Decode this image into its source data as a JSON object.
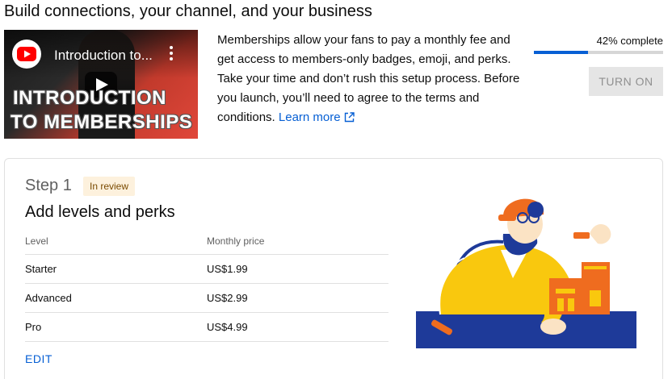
{
  "header": {
    "title": "Build connections, your channel, and your business"
  },
  "video": {
    "title": "Introduction to...",
    "overlay_line1": "INTRODUCTION",
    "overlay_line2": "TO MEMBERSHIPS",
    "logo_icon": "youtube-logo-icon",
    "menu_icon": "kebab-menu-icon",
    "play_icon": "play-icon"
  },
  "description": {
    "text": "Memberships allow your fans to pay a monthly fee and get access to members-only badges, emoji, and perks. Take your time and don’t rush this setup process. Before you launch, you’ll need to agree to the terms and conditions.",
    "link_label": "Learn more",
    "link_icon": "external-link-icon"
  },
  "progress": {
    "label": "42% complete",
    "value": 0.42
  },
  "actions": {
    "turn_on_label": "TURN ON"
  },
  "step": {
    "label": "Step 1",
    "status_badge": "In review",
    "title": "Add levels and perks",
    "table": {
      "columns": [
        "Level",
        "Monthly price"
      ],
      "rows": [
        {
          "level": "Starter",
          "price": "US$1.99"
        },
        {
          "level": "Advanced",
          "price": "US$2.99"
        },
        {
          "level": "Pro",
          "price": "US$4.99"
        }
      ]
    },
    "edit_label": "EDIT"
  },
  "colors": {
    "accent": "#065fd4",
    "badge_bg": "#fdf1dd",
    "badge_text": "#7a4a00",
    "illustration_yellow": "#f9c80e",
    "illustration_orange": "#ef6c1f",
    "illustration_blue": "#1e3a99"
  }
}
